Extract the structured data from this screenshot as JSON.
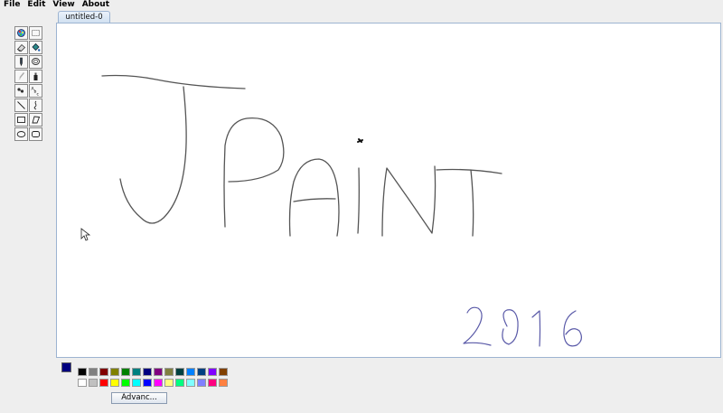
{
  "menu": [
    "File",
    "Edit",
    "View",
    "About"
  ],
  "tools": [
    {
      "name": "color-picker-icon"
    },
    {
      "name": "rectangle-select-icon"
    },
    {
      "name": "eraser-icon"
    },
    {
      "name": "fill-bucket-icon"
    },
    {
      "name": "pencil-icon"
    },
    {
      "name": "lasso-icon"
    },
    {
      "name": "brush-icon"
    },
    {
      "name": "spray-icon"
    },
    {
      "name": "zoom-icon"
    },
    {
      "name": "text-icon"
    },
    {
      "name": "line-icon"
    },
    {
      "name": "curve-icon"
    },
    {
      "name": "rectangle-icon"
    },
    {
      "name": "polygon-icon"
    },
    {
      "name": "ellipse-icon"
    },
    {
      "name": "rounded-rectangle-icon"
    }
  ],
  "tab": {
    "label": "untitled-0"
  },
  "current_color": "#00007f",
  "palette": {
    "row1": [
      "#000000",
      "#808080",
      "#800000",
      "#808000",
      "#008000",
      "#008080",
      "#000080",
      "#800080",
      "#808040",
      "#004040",
      "#0080ff",
      "#004080",
      "#8000ff",
      "#804000"
    ],
    "row2": [
      "#ffffff",
      "#c0c0c0",
      "#ff0000",
      "#ffff00",
      "#00ff00",
      "#00ffff",
      "#0000ff",
      "#ff00ff",
      "#ffff80",
      "#00ff80",
      "#80ffff",
      "#8080ff",
      "#ff0080",
      "#ff8040"
    ]
  },
  "advanced_label": "Advanc..."
}
